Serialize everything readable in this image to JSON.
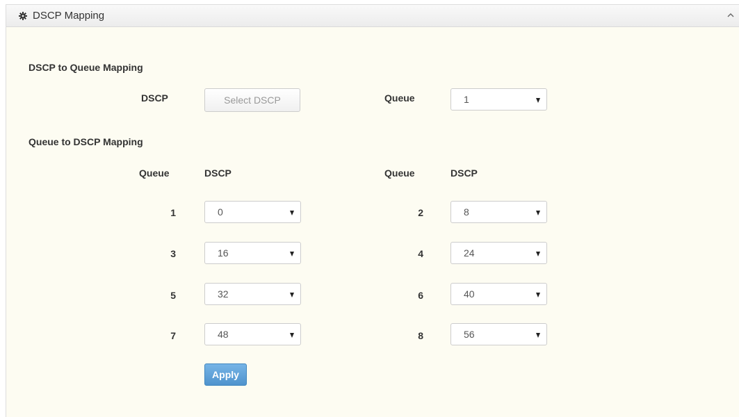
{
  "panel": {
    "title": "DSCP Mapping",
    "header_icon": "gear-icon",
    "collapse_icon": "chevron-up-icon"
  },
  "dscp_to_queue": {
    "title": "DSCP to Queue Mapping",
    "dscp_label": "DSCP",
    "dscp_button": "Select DSCP",
    "queue_label": "Queue",
    "queue_value": "1"
  },
  "queue_to_dscp": {
    "title": "Queue to DSCP Mapping",
    "headers": {
      "left_queue": "Queue",
      "left_dscp": "DSCP",
      "right_queue": "Queue",
      "right_dscp": "DSCP"
    },
    "rows": [
      {
        "queue": "1",
        "dscp": "0"
      },
      {
        "queue": "2",
        "dscp": "8"
      },
      {
        "queue": "3",
        "dscp": "16"
      },
      {
        "queue": "4",
        "dscp": "24"
      },
      {
        "queue": "5",
        "dscp": "32"
      },
      {
        "queue": "6",
        "dscp": "40"
      },
      {
        "queue": "7",
        "dscp": "48"
      },
      {
        "queue": "8",
        "dscp": "56"
      }
    ]
  },
  "apply_label": "Apply",
  "colors": {
    "panel_bg": "#fdfcf2",
    "apply_button": "#5a9fd8"
  }
}
